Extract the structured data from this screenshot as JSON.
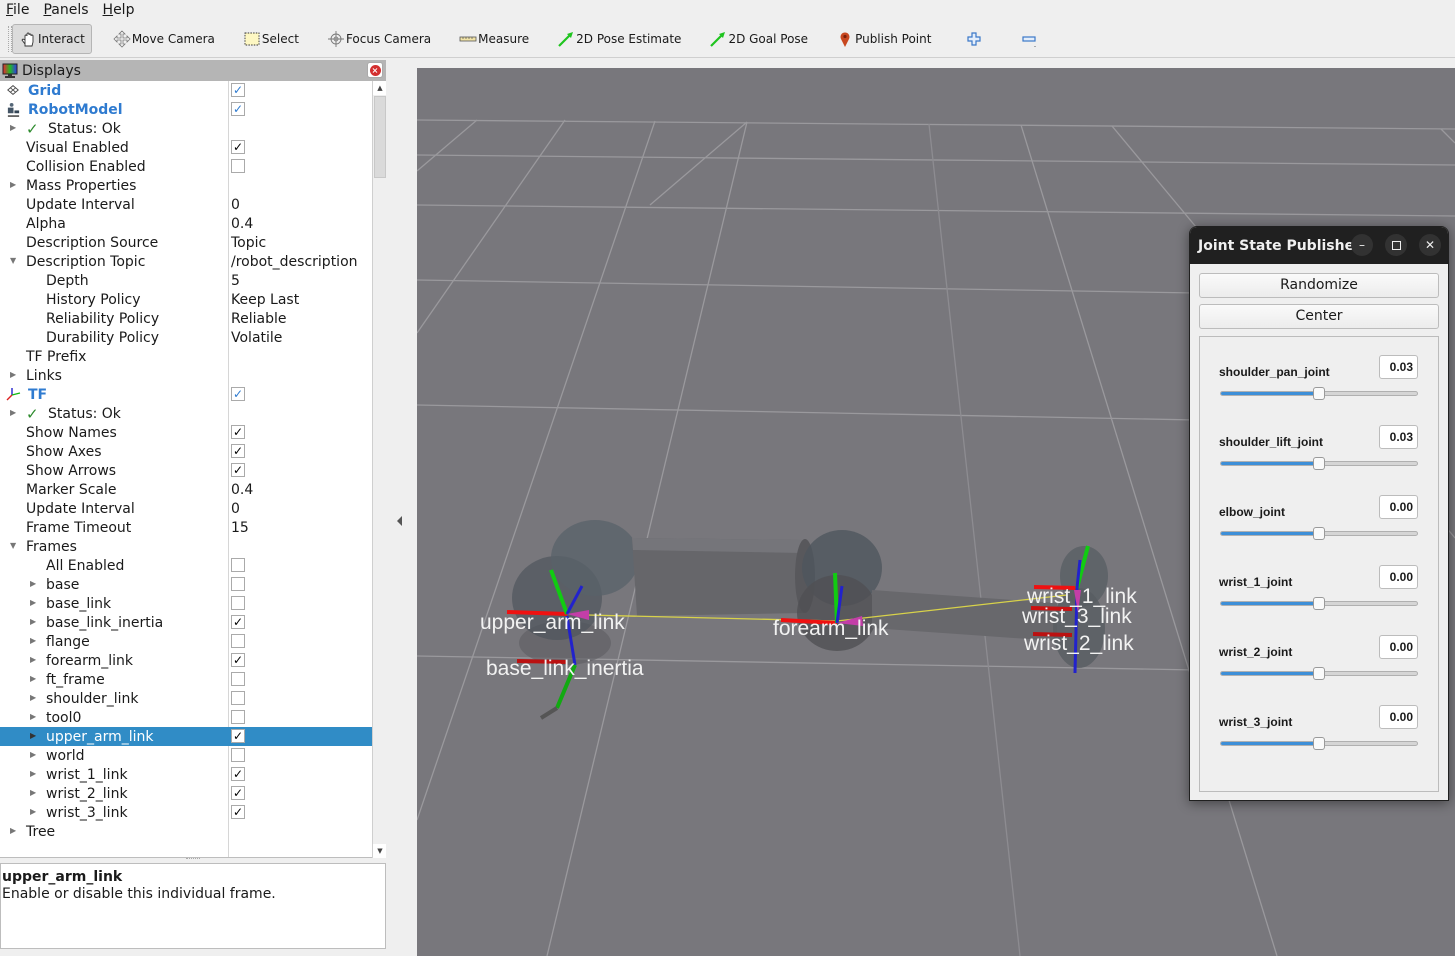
{
  "menu": {
    "items": [
      {
        "label": "File",
        "accel": "F",
        "rest": "ile"
      },
      {
        "label": "Panels",
        "accel": "P",
        "rest": "anels"
      },
      {
        "label": "Help",
        "accel": "H",
        "rest": "elp"
      }
    ]
  },
  "toolbar": {
    "tools": [
      {
        "id": "interact",
        "label": "Interact",
        "icon": "hand-pointer-icon",
        "active": true
      },
      {
        "id": "move-camera",
        "label": "Move Camera",
        "icon": "move-arrows-icon",
        "active": false
      },
      {
        "id": "select",
        "label": "Select",
        "icon": "select-rectangle-icon",
        "active": false
      },
      {
        "id": "focus-camera",
        "label": "Focus Camera",
        "icon": "crosshair-icon",
        "active": false
      },
      {
        "id": "measure",
        "label": "Measure",
        "icon": "ruler-icon",
        "active": false
      },
      {
        "id": "2d-pose-estimate",
        "label": "2D Pose Estimate",
        "icon": "green-arrow-icon",
        "active": false
      },
      {
        "id": "2d-goal-pose",
        "label": "2D Goal Pose",
        "icon": "green-arrow-icon",
        "active": false
      },
      {
        "id": "publish-point",
        "label": "Publish Point",
        "icon": "map-pin-icon",
        "active": false
      }
    ],
    "add_tool_icon": "plus-icon",
    "remove_tool_icon": "minus-icon"
  },
  "displays": {
    "title": "Displays",
    "rows": [
      {
        "label": "Grid",
        "style": "display",
        "icon": "grid-icon",
        "checkbox": true,
        "checked": true,
        "indent": 0
      },
      {
        "label": "RobotModel",
        "style": "display",
        "icon": "robot-icon",
        "checkbox": true,
        "checked": true,
        "indent": 0
      },
      {
        "label": "Status: Ok",
        "style": "status",
        "expander": "collapsed",
        "indent": 1
      },
      {
        "label": "Visual Enabled",
        "checkbox": true,
        "checked": true,
        "indent": 1
      },
      {
        "label": "Collision Enabled",
        "checkbox": true,
        "checked": false,
        "indent": 1
      },
      {
        "label": "Mass Properties",
        "expander": "collapsed",
        "indent": 1
      },
      {
        "label": "Update Interval",
        "value": "0",
        "indent": 1
      },
      {
        "label": "Alpha",
        "value": "0.4",
        "indent": 1
      },
      {
        "label": "Description Source",
        "value": "Topic",
        "indent": 1
      },
      {
        "label": "Description Topic",
        "value": "/robot_description",
        "expander": "expanded",
        "indent": 1
      },
      {
        "label": "Depth",
        "value": "5",
        "indent": 2
      },
      {
        "label": "History Policy",
        "value": "Keep Last",
        "indent": 2
      },
      {
        "label": "Reliability Policy",
        "value": "Reliable",
        "indent": 2
      },
      {
        "label": "Durability Policy",
        "value": "Volatile",
        "indent": 2
      },
      {
        "label": "TF Prefix",
        "value": "",
        "indent": 1
      },
      {
        "label": "Links",
        "expander": "collapsed",
        "indent": 1
      },
      {
        "label": "TF",
        "style": "display",
        "icon": "tf-axes-icon",
        "checkbox": true,
        "checked": true,
        "indent": 0
      },
      {
        "label": "Status: Ok",
        "style": "status",
        "expander": "collapsed",
        "indent": 1
      },
      {
        "label": "Show Names",
        "checkbox": true,
        "checked": true,
        "indent": 1
      },
      {
        "label": "Show Axes",
        "checkbox": true,
        "checked": true,
        "indent": 1
      },
      {
        "label": "Show Arrows",
        "checkbox": true,
        "checked": true,
        "indent": 1
      },
      {
        "label": "Marker Scale",
        "value": "0.4",
        "indent": 1
      },
      {
        "label": "Update Interval",
        "value": "0",
        "indent": 1
      },
      {
        "label": "Frame Timeout",
        "value": "15",
        "indent": 1
      },
      {
        "label": "Frames",
        "expander": "expanded",
        "indent": 1
      },
      {
        "label": "All Enabled",
        "checkbox": true,
        "checked": false,
        "indent": 2
      },
      {
        "label": "base",
        "expander": "collapsed",
        "checkbox": true,
        "checked": false,
        "indent": 2
      },
      {
        "label": "base_link",
        "expander": "collapsed",
        "checkbox": true,
        "checked": false,
        "indent": 2
      },
      {
        "label": "base_link_inertia",
        "expander": "collapsed",
        "checkbox": true,
        "checked": true,
        "indent": 2
      },
      {
        "label": "flange",
        "expander": "collapsed",
        "checkbox": true,
        "checked": false,
        "indent": 2
      },
      {
        "label": "forearm_link",
        "expander": "collapsed",
        "checkbox": true,
        "checked": true,
        "indent": 2
      },
      {
        "label": "ft_frame",
        "expander": "collapsed",
        "checkbox": true,
        "checked": false,
        "indent": 2
      },
      {
        "label": "shoulder_link",
        "expander": "collapsed",
        "checkbox": true,
        "checked": false,
        "indent": 2
      },
      {
        "label": "tool0",
        "expander": "collapsed",
        "checkbox": true,
        "checked": false,
        "indent": 2
      },
      {
        "label": "upper_arm_link",
        "expander": "collapsed",
        "checkbox": true,
        "checked": true,
        "indent": 2,
        "selected": true
      },
      {
        "label": "world",
        "expander": "collapsed",
        "checkbox": true,
        "checked": false,
        "indent": 2
      },
      {
        "label": "wrist_1_link",
        "expander": "collapsed",
        "checkbox": true,
        "checked": true,
        "indent": 2
      },
      {
        "label": "wrist_2_link",
        "expander": "collapsed",
        "checkbox": true,
        "checked": true,
        "indent": 2
      },
      {
        "label": "wrist_3_link",
        "expander": "collapsed",
        "checkbox": true,
        "checked": true,
        "indent": 2
      },
      {
        "label": "Tree",
        "expander": "collapsed",
        "indent": 1
      }
    ],
    "description": {
      "title": "upper_arm_link",
      "text": "Enable or disable this individual frame."
    }
  },
  "view3d": {
    "background": "#78777c",
    "frame_labels": [
      {
        "id": "upper_arm_link",
        "text": "upper_arm_link"
      },
      {
        "id": "base_link_inertia",
        "text": "base_link_inertia"
      },
      {
        "id": "forearm_link",
        "text": "forearm_link"
      },
      {
        "id": "wrist_1_link",
        "text": "wrist_1_link"
      },
      {
        "id": "wrist_3_link",
        "text": "wrist_3_link"
      },
      {
        "id": "wrist_2_link",
        "text": "wrist_2_link"
      }
    ]
  },
  "joint_state_publisher": {
    "title": "Joint State Publisher",
    "randomize_label": "Randomize",
    "center_label": "Center",
    "joints": [
      {
        "name": "shoulder_pan_joint",
        "value": "0.03",
        "slider_fraction": 0.5
      },
      {
        "name": "shoulder_lift_joint",
        "value": "0.03",
        "slider_fraction": 0.5
      },
      {
        "name": "elbow_joint",
        "value": "0.00",
        "slider_fraction": 0.5
      },
      {
        "name": "wrist_1_joint",
        "value": "0.00",
        "slider_fraction": 0.5
      },
      {
        "name": "wrist_2_joint",
        "value": "0.00",
        "slider_fraction": 0.5
      },
      {
        "name": "wrist_3_joint",
        "value": "0.00",
        "slider_fraction": 0.5
      }
    ]
  }
}
